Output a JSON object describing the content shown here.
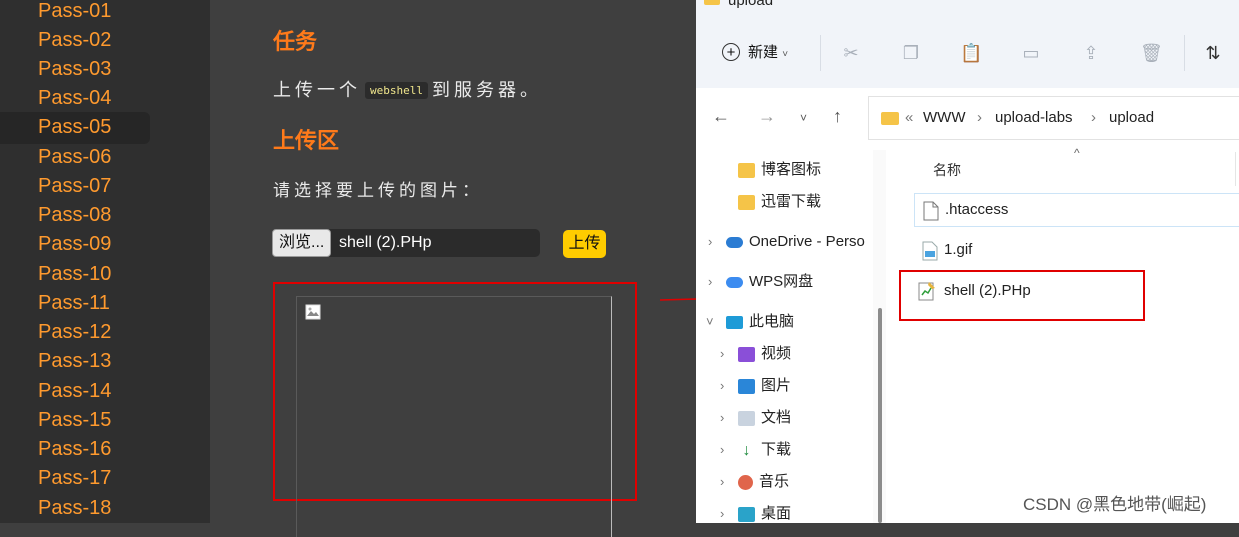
{
  "sidebar": {
    "active": "Pass-05",
    "items": [
      "Pass-01",
      "Pass-02",
      "Pass-03",
      "Pass-04",
      "Pass-05",
      "Pass-06",
      "Pass-07",
      "Pass-08",
      "Pass-09",
      "Pass-10",
      "Pass-11",
      "Pass-12",
      "Pass-13",
      "Pass-14",
      "Pass-15",
      "Pass-16",
      "Pass-17",
      "Pass-18"
    ]
  },
  "content": {
    "task_title": "任务",
    "task_prefix": "上传一个",
    "task_code": "webshell",
    "task_suffix": "到服务器。",
    "upload_title": "上传区",
    "choose_label": "请选择要上传的图片：",
    "browse_label": "浏览...",
    "file_value": "shell (2).PHp",
    "upload_label": "上传"
  },
  "explorer": {
    "window_title": "upload",
    "new_label": "新建",
    "address": [
      "«",
      "WWW",
      "›",
      "upload-labs",
      "›",
      "upload"
    ],
    "nav": {
      "blog_icons": "博客图标",
      "xunlei": "迅雷下载",
      "onedrive": "OneDrive - Perso",
      "wps": "WPS网盘",
      "this_pc": "此电脑",
      "videos": "视频",
      "pictures": "图片",
      "documents": "文档",
      "downloads": "下载",
      "music": "音乐",
      "desktop": "桌面"
    },
    "column_name": "名称",
    "files": [
      ".htaccess",
      "1.gif",
      "shell (2).PHp"
    ]
  },
  "watermark": "CSDN @黑色地带(崛起)",
  "colors": {
    "accent_orange": "#ff7a1a",
    "sidebar_text": "#ff9a2e",
    "upload_button": "#ffcc00",
    "highlight_red": "#e00000"
  }
}
